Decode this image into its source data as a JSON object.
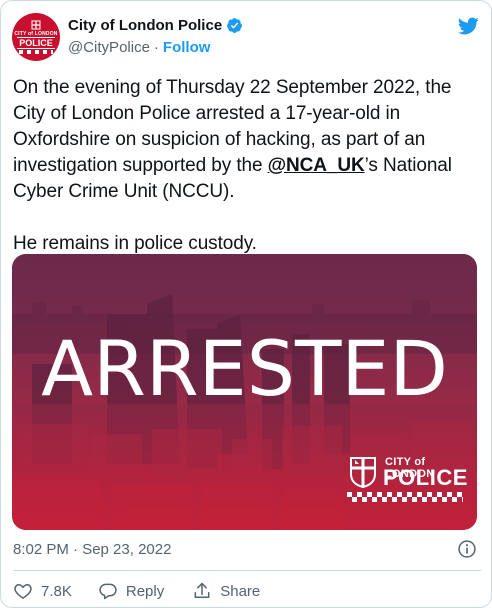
{
  "author": {
    "display_name": "City of London Police",
    "handle": "@CityPolice",
    "separator": "·",
    "follow_label": "Follow",
    "avatar_text_top": "CITY of LONDON",
    "avatar_text_main": "POLICE"
  },
  "tweet": {
    "paragraph1_part1": "On the evening of Thursday 22 September 2022, the City of London Police arrested a 17-year-old in Oxfordshire on suspicion of hacking, as part of an investigation supported by the ",
    "mention": "@NCA_UK",
    "paragraph1_part2": "’s National Cyber Crime Unit (NCCU).",
    "paragraph2": "He remains in police custody."
  },
  "media": {
    "headline": "ARRESTED",
    "logo_top": "CITY of LONDON",
    "logo_main": "POLICE"
  },
  "meta": {
    "timestamp": "8:02 PM · Sep 23, 2022"
  },
  "actions": {
    "like_count": "7.8K",
    "reply_label": "Reply",
    "share_label": "Share"
  },
  "icons": {
    "brand": "twitter-bird-icon",
    "verified": "verified-badge-icon",
    "info": "info-icon",
    "like": "heart-icon",
    "reply": "reply-bubble-icon",
    "share": "share-icon"
  },
  "colors": {
    "brand_blue": "#1d9bf0",
    "text_primary": "#0f1419",
    "text_secondary": "#536471",
    "police_red": "#c8102e",
    "border": "#cfd9de"
  }
}
